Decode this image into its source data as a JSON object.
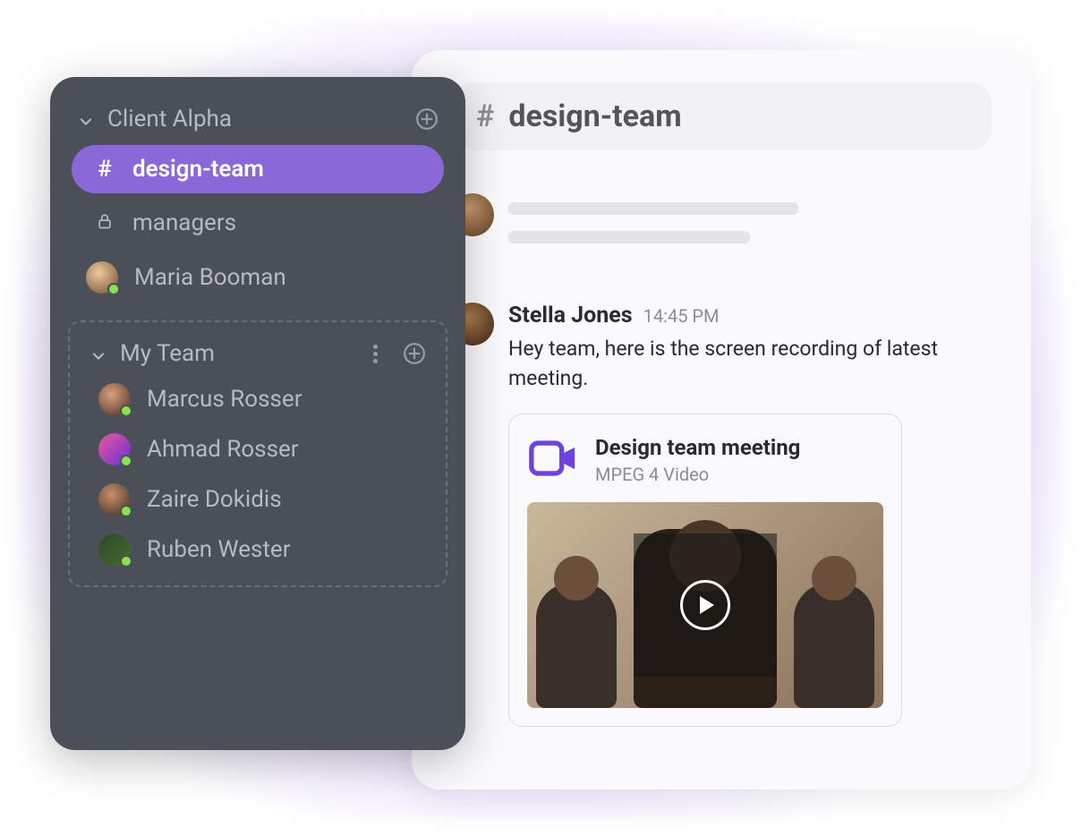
{
  "sidebar": {
    "section1": {
      "title": "Client Alpha",
      "channels": [
        {
          "prefix": "#",
          "name": "design-team",
          "active": true
        },
        {
          "prefix": "lock",
          "name": "managers",
          "active": false
        }
      ],
      "dm": {
        "name": "Maria Booman"
      }
    },
    "section2": {
      "title": "My Team",
      "members": [
        {
          "name": "Marcus Rosser"
        },
        {
          "name": "Ahmad Rosser"
        },
        {
          "name": "Zaire Dokidis"
        },
        {
          "name": "Ruben Wester"
        }
      ]
    }
  },
  "main": {
    "channel_prefix": "#",
    "channel_name": "design-team",
    "message": {
      "author": "Stella Jones",
      "time": "14:45 PM",
      "text": "Hey team, here is the screen recording of latest meeting."
    },
    "attachment": {
      "title": "Design team meeting",
      "subtitle": "MPEG 4 Video"
    }
  }
}
